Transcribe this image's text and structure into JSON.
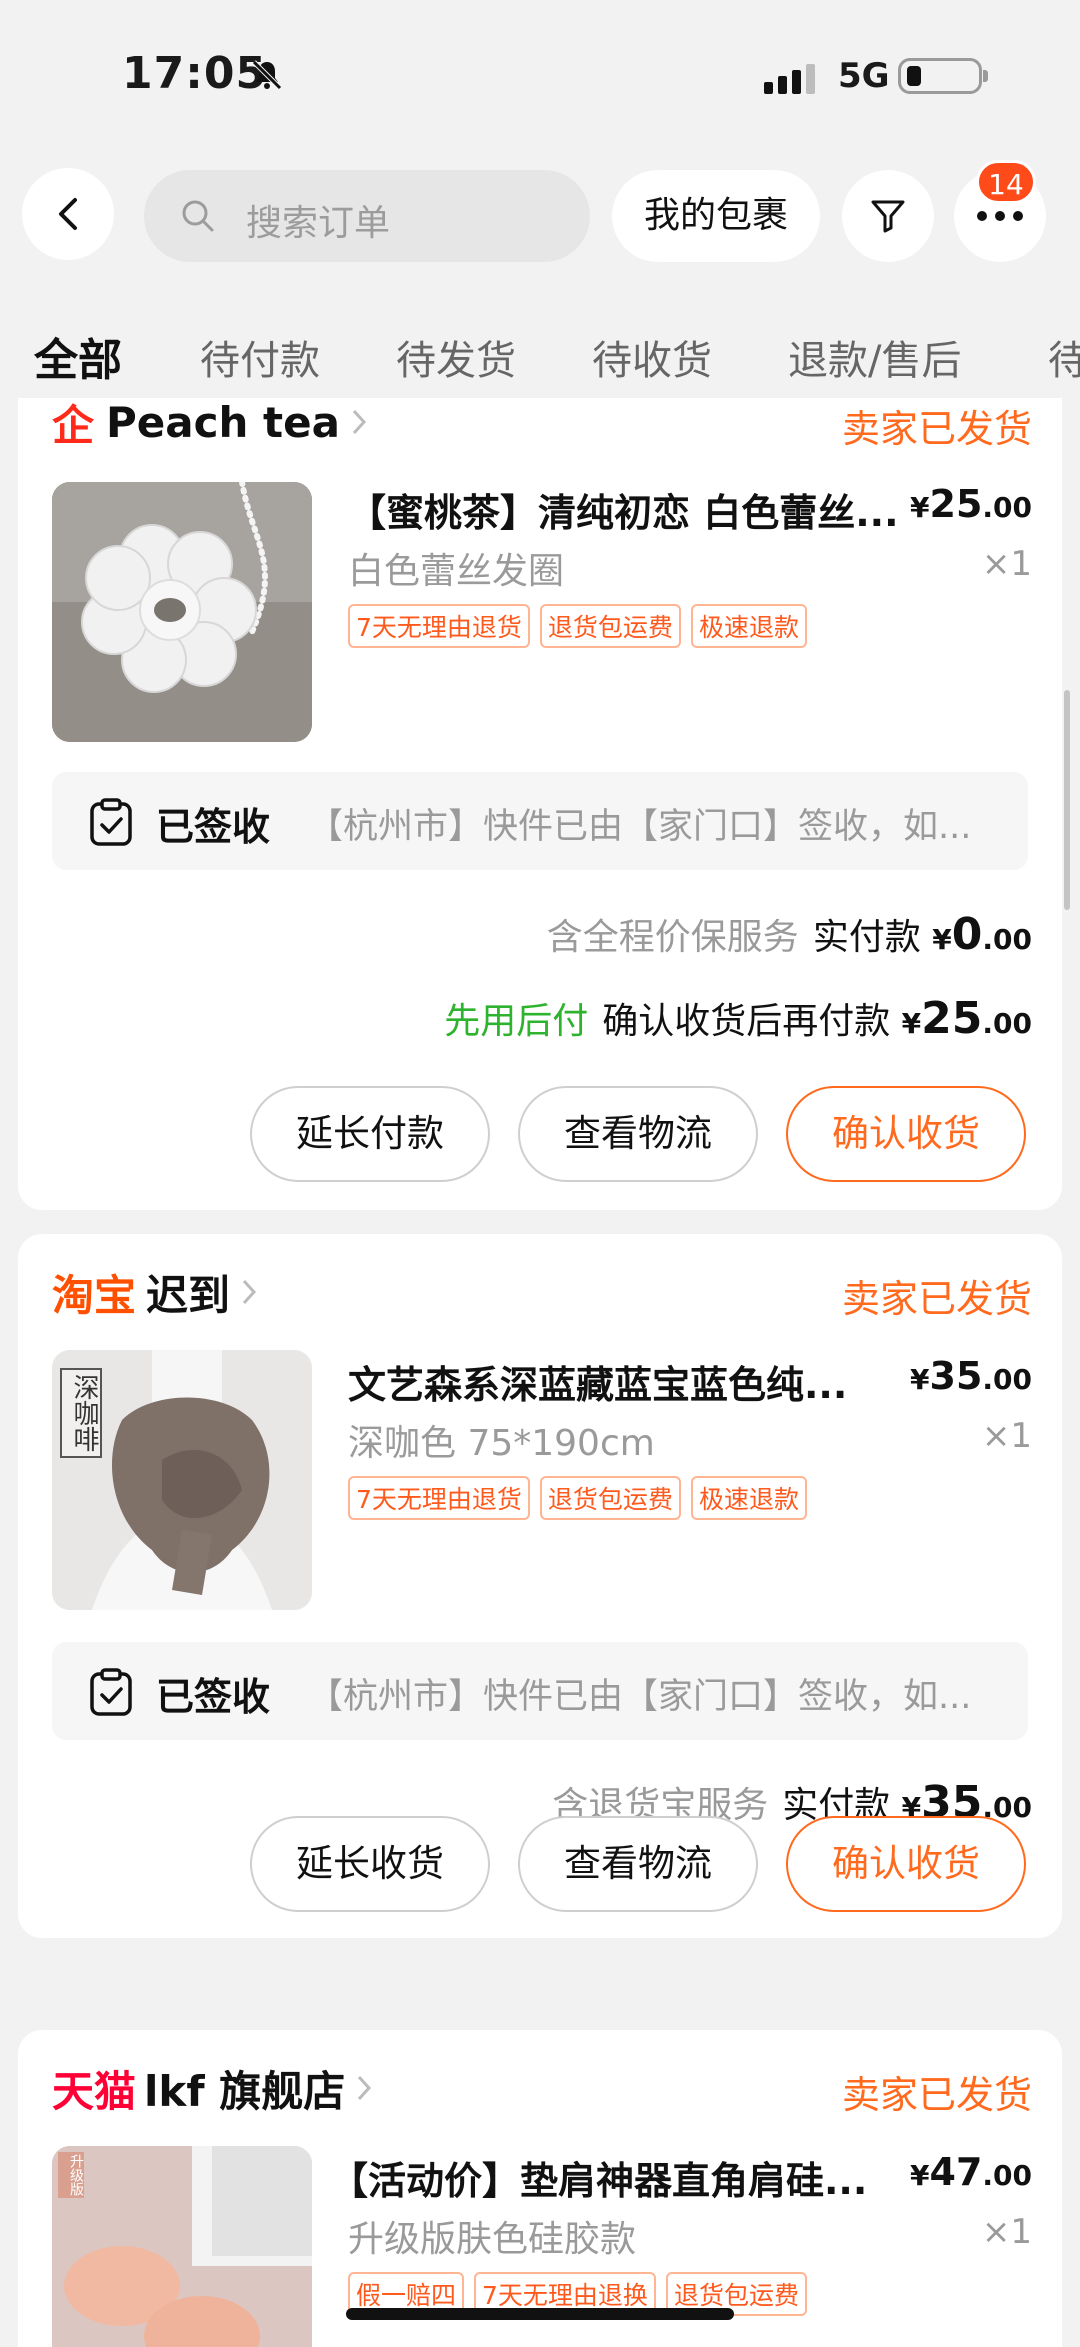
{
  "status_bar": {
    "time": "17:05",
    "network": "5G"
  },
  "header": {
    "search_placeholder": "搜索订单",
    "packages_label": "我的包裹",
    "more_badge": "14"
  },
  "tabs": [
    "全部",
    "待付款",
    "待发货",
    "待收货",
    "退款/售后",
    "待"
  ],
  "orders": [
    {
      "shop_prefix": "企",
      "shop_name": "Peach tea",
      "status": "卖家已发货",
      "title": "【蜜桃茶】清纯初恋 白色蕾丝...",
      "price_int": "25",
      "price_dec": ".00",
      "variant": "白色蕾丝发圈",
      "qty": "×1",
      "tags": [
        "7天无理由退货",
        "退货包运费",
        "极速退款"
      ],
      "logistics_state": "已签收",
      "logistics_detail": "【杭州市】快件已由【家门口】签收，如...",
      "service": "含全程价保服务",
      "paid_label": "实付款",
      "paid_int": "0",
      "paid_dec": ".00",
      "later_label": "先用后付",
      "later_text": "确认收货后再付款",
      "later_int": "25",
      "later_dec": ".00",
      "buttons": [
        "延长付款",
        "查看物流",
        "确认收货"
      ]
    },
    {
      "shop_prefix": "淘宝",
      "shop_name": "迟到",
      "status": "卖家已发货",
      "title": "文艺森系深蓝藏蓝宝蓝色纯...",
      "price_int": "35",
      "price_dec": ".00",
      "variant": "深咖色 75*190cm",
      "qty": "×1",
      "thumb_text": "深咖啡",
      "tags": [
        "7天无理由退货",
        "退货包运费",
        "极速退款"
      ],
      "logistics_state": "已签收",
      "logistics_detail": "【杭州市】快件已由【家门口】签收，如...",
      "service": "含退货宝服务",
      "paid_label": "实付款",
      "paid_int": "35",
      "paid_dec": ".00",
      "buttons": [
        "延长收货",
        "查看物流",
        "确认收货"
      ]
    },
    {
      "shop_prefix": "天猫",
      "shop_name": "lkf 旗舰店",
      "status": "卖家已发货",
      "title": "【活动价】垫肩神器直角肩硅...",
      "price_int": "47",
      "price_dec": ".00",
      "variant": "升级版肤色硅胶款",
      "qty": "×1",
      "thumb_badge": "升级版",
      "tags": [
        "假一赔四",
        "7天无理由退换",
        "退货包运费"
      ]
    }
  ],
  "currency": "¥",
  "colors": {
    "accent": "#ff6a1e",
    "green": "#2db32d",
    "tmall": "#ff0036"
  }
}
